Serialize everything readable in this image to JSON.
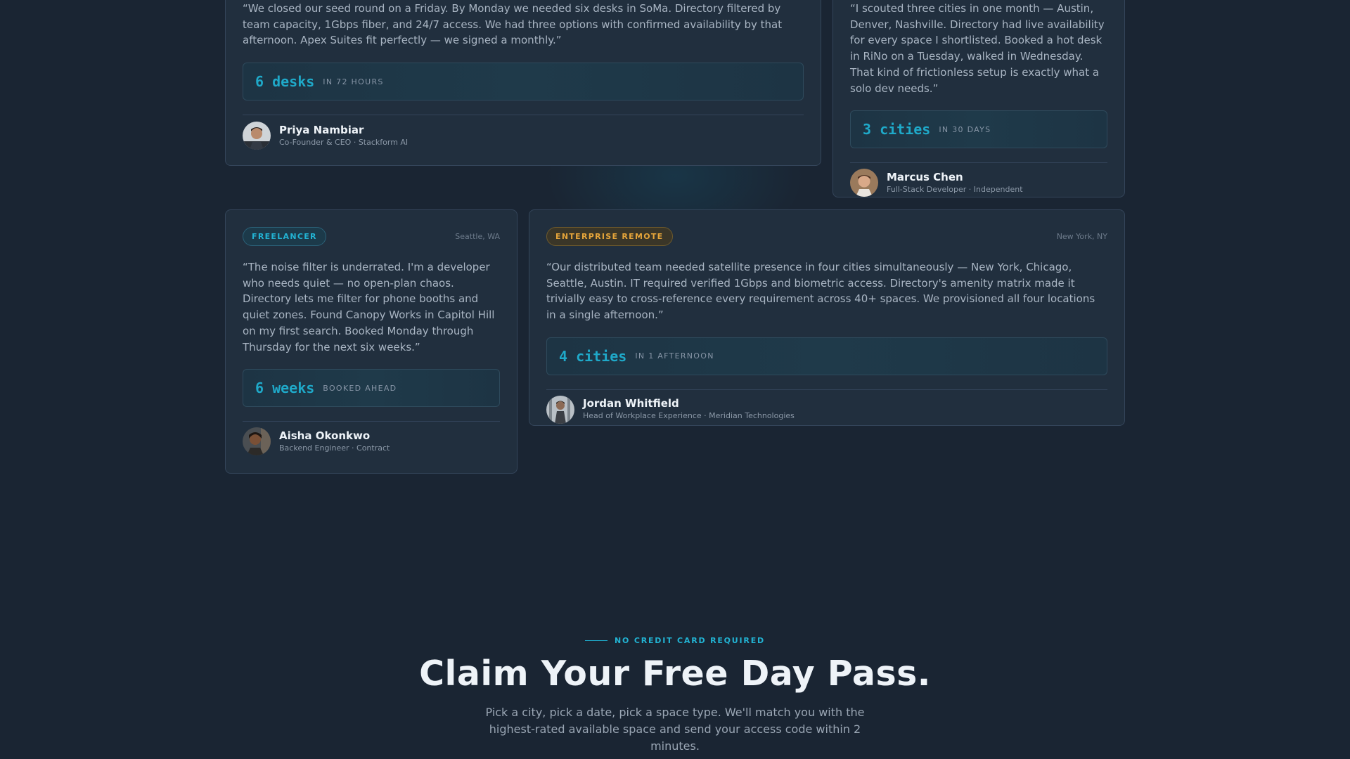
{
  "testimonials": [
    {
      "quote": "“We closed our seed round on a Friday. By Monday we needed six desks in SoMa. Directory filtered by team capacity, 1Gbps fiber, and 24/7 access. We had three options with confirmed availability by that afternoon. Apex Suites fit perfectly — we signed a monthly.”",
      "stat_value": "6 desks",
      "stat_label": "IN 72 HOURS",
      "author_name": "Priya Nambiar",
      "author_role": "Co-Founder & CEO · Stackform AI"
    },
    {
      "quote": "“I scouted three cities in one month — Austin, Denver, Nashville. Directory had live availability for every space I shortlisted. Booked a hot desk in RiNo on a Tuesday, walked in Wednesday. That kind of frictionless setup is exactly what a solo dev needs.”",
      "stat_value": "3 cities",
      "stat_label": "IN 30 DAYS",
      "author_name": "Marcus Chen",
      "author_role": "Full-Stack Developer · Independent"
    },
    {
      "badge": "FREELANCER",
      "location": "Seattle, WA",
      "quote": "“The noise filter is underrated. I'm a developer who needs quiet — no open-plan chaos. Directory lets me filter for phone booths and quiet zones. Found Canopy Works in Capitol Hill on my first search. Booked Monday through Thursday for the next six weeks.”",
      "stat_value": "6 weeks",
      "stat_label": "BOOKED AHEAD",
      "author_name": "Aisha Okonkwo",
      "author_role": "Backend Engineer · Contract"
    },
    {
      "badge": "ENTERPRISE REMOTE",
      "location": "New York, NY",
      "quote": "“Our distributed team needed satellite presence in four cities simultaneously — New York, Chicago, Seattle, Austin. IT required verified 1Gbps and biometric access. Directory's amenity matrix made it trivially easy to cross-reference every requirement across 40+ spaces. We provisioned all four locations in a single afternoon.”",
      "stat_value": "4 cities",
      "stat_label": "IN 1 AFTERNOON",
      "author_name": "Jordan Whitfield",
      "author_role": "Head of Workplace Experience · Meridian Technologies"
    }
  ],
  "cta": {
    "eyebrow": "NO CREDIT CARD REQUIRED",
    "headline": "Claim Your Free Day Pass.",
    "subtext": "Pick a city, pick a date, pick a space type. We'll match you with the highest-rated available space and send your access code within 2 minutes."
  },
  "colors": {
    "background": "#1a2533",
    "card": "#212f3e",
    "accent_cyan": "#1fa9c9",
    "accent_amber": "#e6a53a"
  },
  "icons": [
    "avatar-photo"
  ]
}
